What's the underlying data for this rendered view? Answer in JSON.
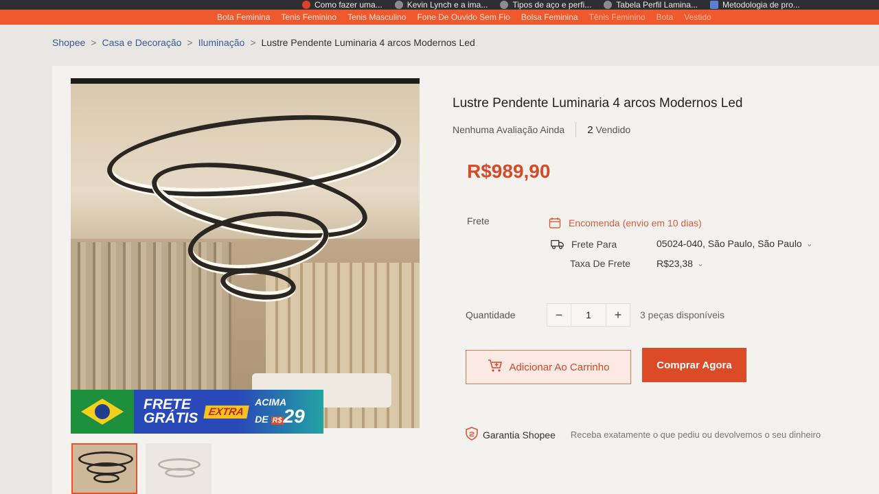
{
  "bookmarks": [
    {
      "label": "Como fazer uma...",
      "icon": "youtube-icon"
    },
    {
      "label": "Kevin Lynch e a ima...",
      "icon": "site-icon"
    },
    {
      "label": "Tipos de aço e perfi...",
      "icon": "globe-icon"
    },
    {
      "label": "Tabela Perfil Lamina...",
      "icon": "globe-icon"
    },
    {
      "label": "Metodologia de pro...",
      "icon": "doc-icon"
    }
  ],
  "header_links": [
    "Bota Feminina",
    "Tenis Feminino",
    "Tenis Masculino",
    "Fone De Ouvido Sem Fio",
    "Bolsa Feminina",
    "Tênis Feminino",
    "Bota",
    "Vestido"
  ],
  "breadcrumb": {
    "items": [
      "Shopee",
      "Casa e Decoração",
      "Iluminação"
    ],
    "current": "Lustre Pendente Luminaria 4 arcos Modernos Led"
  },
  "promo": {
    "frete": "FRETE",
    "gratis": "GRÁTIS",
    "extra": "EXTRA",
    "acima": "ACIMA",
    "de": "DE",
    "currency": "R$",
    "amount": "29"
  },
  "product": {
    "title": "Lustre Pendente Luminaria 4 arcos Modernos Led",
    "rating_text": "Nenhuma Avaliação Ainda",
    "sold_count": "2",
    "sold_label": "Vendido",
    "price": "R$989,90"
  },
  "shipping": {
    "label": "Frete",
    "encomenda": "Encomenda (envio em 10 dias)",
    "frete_para_label": "Frete Para",
    "frete_para_value": "05024-040, São Paulo, São Paulo",
    "taxa_label": "Taxa De Frete",
    "taxa_value": "R$23,38"
  },
  "quantity": {
    "label": "Quantidade",
    "value": "1",
    "minus": "−",
    "plus": "+",
    "available": "3 peças disponíveis"
  },
  "actions": {
    "add_to_cart": "Adicionar Ao Carrinho",
    "buy_now": "Comprar Agora"
  },
  "guarantee": {
    "name": "Garantia Shopee",
    "description": "Receba exatamente o que pediu ou devolvemos o seu dinheiro"
  },
  "colors": {
    "brand": "#ee4d2d",
    "price": "#d74a26",
    "buy_button": "#dc4a28"
  }
}
